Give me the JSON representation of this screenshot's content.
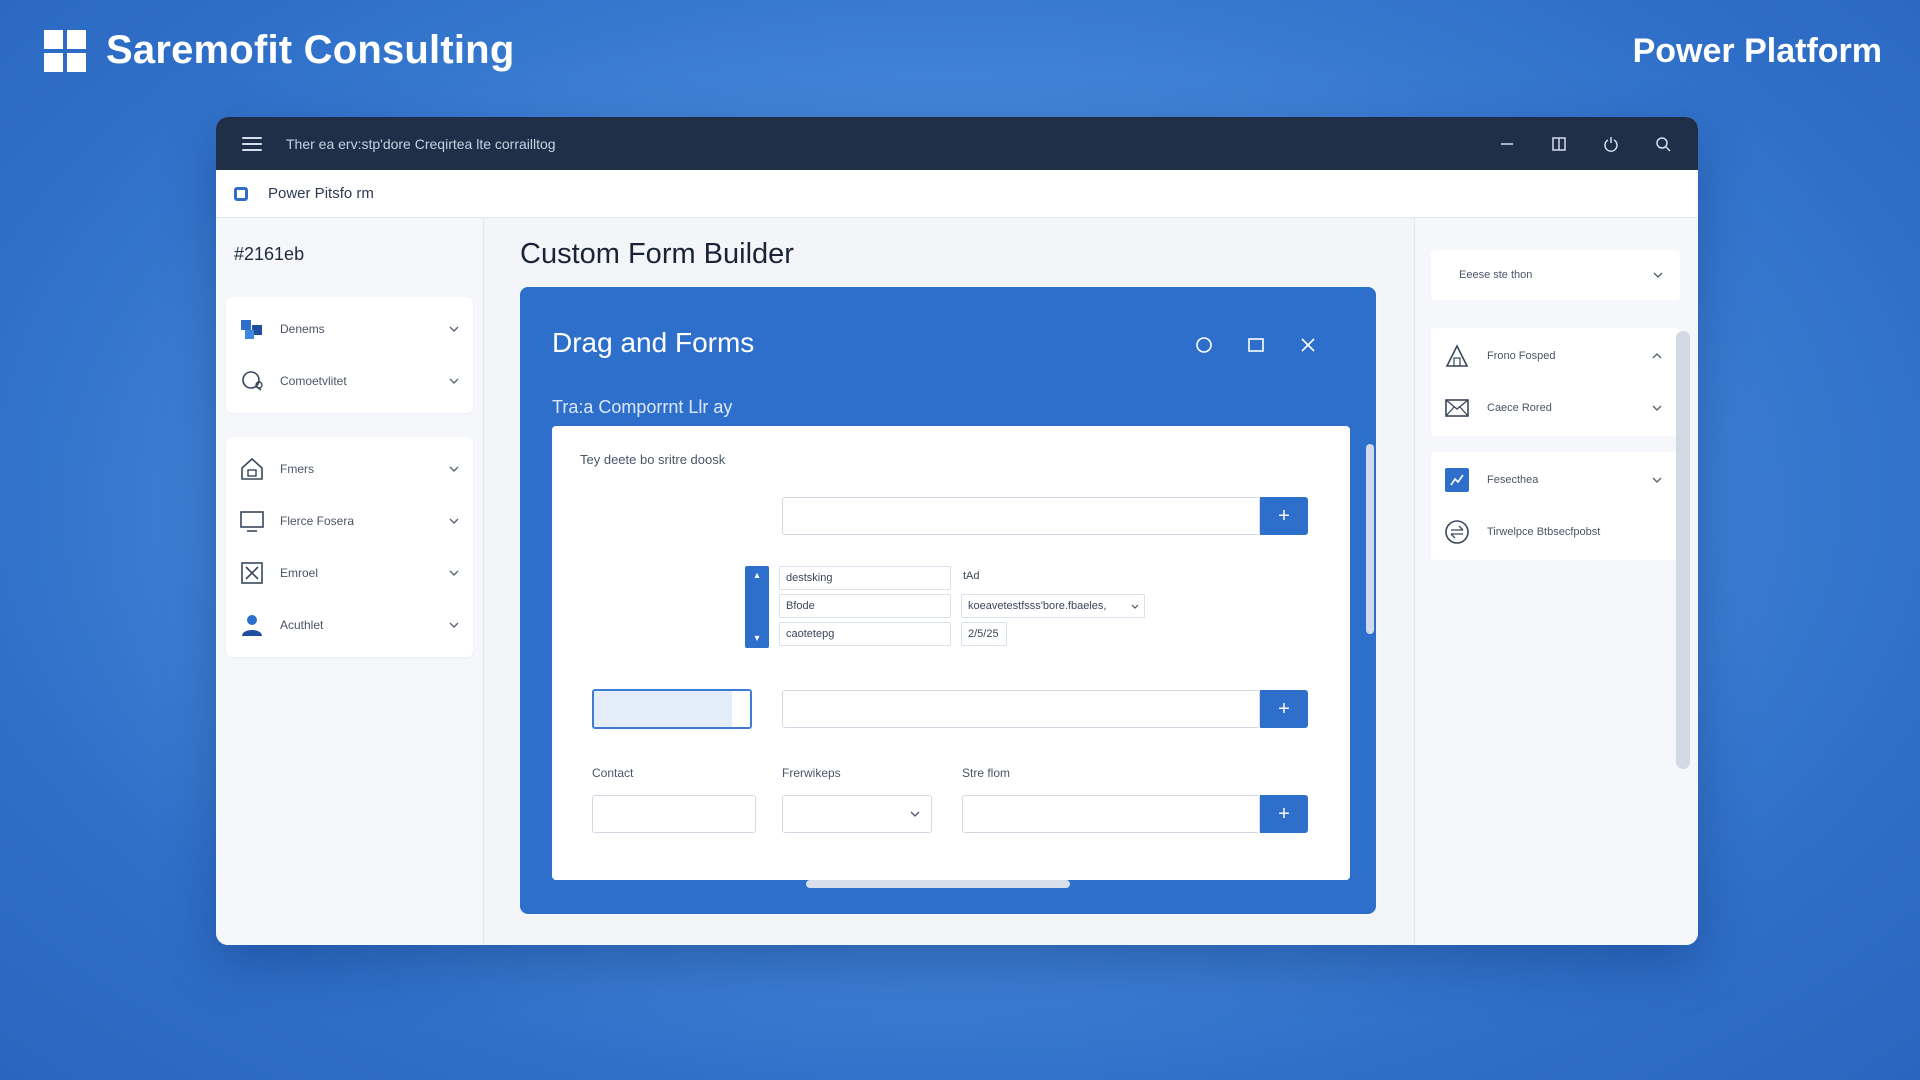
{
  "brand": {
    "title": "Saremofit Consulting",
    "product": "Power Platform"
  },
  "window": {
    "titlebar_text": "Ther ea erv:stp'dore Creqirtea lte corrailltog",
    "subbar_label": "Power Pitsfo rm"
  },
  "sidebar": {
    "code": "#2161eb",
    "groups": [
      {
        "items": [
          {
            "label": "Denems",
            "icon": "components-icon"
          },
          {
            "label": "Comoetvlitet",
            "icon": "chat-icon"
          }
        ]
      },
      {
        "items": [
          {
            "label": "Fmers",
            "icon": "home-icon"
          },
          {
            "label": "Flerce Fosera",
            "icon": "monitor-icon"
          },
          {
            "label": "Emroel",
            "icon": "close-box-icon"
          },
          {
            "label": "Acuthlet",
            "icon": "user-icon"
          }
        ]
      }
    ]
  },
  "main": {
    "title": "Custom Form Builder",
    "panel": {
      "title": "Drag and Forms",
      "subtitle": "Tra:a Comporrnt Llr ay",
      "hint": "Tey deete bo sritre doosk",
      "mini_table": {
        "col1": [
          "destsking",
          "Bfode",
          "caotetepg"
        ],
        "col2": [
          "tAd",
          "koeavetestfsss'bore.fbaeles,",
          "2/5/25"
        ]
      },
      "labels": {
        "contact": "Contact",
        "prerequisites": "Frerwikeps",
        "store": "Stre flom"
      },
      "add_symbol": "+"
    }
  },
  "rightbar": {
    "select_placeholder": "Eeese ste thon",
    "groups": [
      {
        "items": [
          {
            "label": "Frono Fosped",
            "icon": "triangle-alert-icon",
            "chevron": "up"
          },
          {
            "label": "Caece Rored",
            "icon": "mail-icon",
            "chevron": "down"
          }
        ]
      },
      {
        "items": [
          {
            "label": "Fesecthea",
            "icon": "chart-icon",
            "chevron": "down"
          },
          {
            "label": "Tirwelpce Btbsecfpobst",
            "icon": "transfer-icon",
            "chevron": "none"
          }
        ]
      }
    ]
  },
  "colors": {
    "accent": "#2e6fcb",
    "titlebar": "#1f2f48",
    "background": "#3f82d6"
  }
}
